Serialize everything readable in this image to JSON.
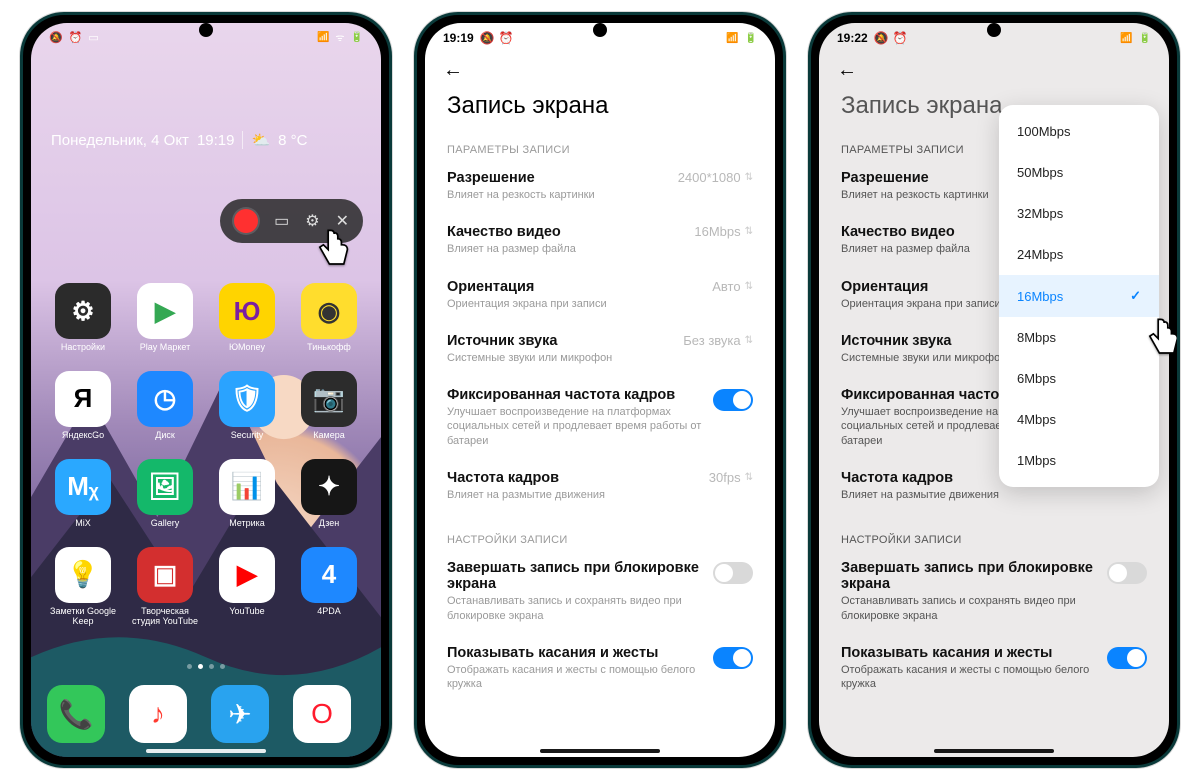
{
  "phone1": {
    "status_time_implicit": "",
    "clock_day": "Понедельник, 4 Окт",
    "clock_time": "19:19",
    "weather_temp": "8 °C",
    "apps": [
      {
        "label": "Настройки",
        "bg": "#2b2b2b",
        "glyph": "⚙"
      },
      {
        "label": "Play Маркет",
        "bg": "#ffffff",
        "glyph": "▶",
        "fg": "#34a853"
      },
      {
        "label": "ЮMoney",
        "bg": "#ffd400",
        "glyph": "Ю",
        "fg": "#7b1fa2"
      },
      {
        "label": "Тинькофф",
        "bg": "#ffdd2d",
        "glyph": "◉",
        "fg": "#333"
      },
      {
        "label": "ЯндексGo",
        "bg": "#ffffff",
        "glyph": "Я",
        "fg": "#000"
      },
      {
        "label": "Диск",
        "bg": "#1e88ff",
        "glyph": "◷"
      },
      {
        "label": "Security",
        "bg": "#2aa3ff",
        "glyph": "🛡"
      },
      {
        "label": "Камера",
        "bg": "#2c2c2c",
        "glyph": "📷"
      },
      {
        "label": "MiX",
        "bg": "#2aa8ff",
        "glyph": "Mᵪ"
      },
      {
        "label": "Gallery",
        "bg": "#14b86a",
        "glyph": "🖼"
      },
      {
        "label": "Метрика",
        "bg": "#ffffff",
        "glyph": "📊",
        "fg": "#333"
      },
      {
        "label": "Дзен",
        "bg": "#161616",
        "glyph": "✦"
      },
      {
        "label": "Заметки Google Keep",
        "bg": "#ffffff",
        "glyph": "💡",
        "fg": "#f4b400"
      },
      {
        "label": "Творческая студия YouTube",
        "bg": "#d32f2f",
        "glyph": "▣"
      },
      {
        "label": "YouTube",
        "bg": "#ffffff",
        "glyph": "▶",
        "fg": "#ff0000"
      },
      {
        "label": "4PDA",
        "bg": "#1e88ff",
        "glyph": "4"
      }
    ],
    "dock": [
      {
        "bg": "#33c75a",
        "glyph": "📞"
      },
      {
        "bg": "#ffffff",
        "glyph": "♪",
        "fg": "#ff3b30"
      },
      {
        "bg": "#29a3ef",
        "glyph": "✈"
      },
      {
        "bg": "#ffffff",
        "glyph": "O",
        "fg": "#ff1b2d"
      }
    ]
  },
  "phone2": {
    "status_time": "19:19",
    "title": "Запись экрана",
    "section_params": "ПАРАМЕТРЫ ЗАПИСИ",
    "rows": [
      {
        "name": "Разрешение",
        "sub": "Влияет на резкость картинки",
        "val": "2400*1080"
      },
      {
        "name": "Качество видео",
        "sub": "Влияет на размер файла",
        "val": "16Mbps"
      },
      {
        "name": "Ориентация",
        "sub": "Ориентация экрана при записи",
        "val": "Авто"
      },
      {
        "name": "Источник звука",
        "sub": "Системные звуки или микрофон",
        "val": "Без звука"
      }
    ],
    "fixed_fps": {
      "name": "Фиксированная частота кадров",
      "sub": "Улучшает воспроизведение на платформах социальных сетей и продлевает время работы от батареи"
    },
    "fps": {
      "name": "Частота кадров",
      "sub": "Влияет на размытие движения",
      "val": "30fps"
    },
    "section_rec": "НАСТРОЙКИ ЗАПИСИ",
    "stop_on_lock": {
      "name": "Завершать запись при блокировке экрана",
      "sub": "Останавливать запись и сохранять видео при блокировке экрана"
    },
    "show_touch": {
      "name": "Показывать касания и жесты",
      "sub": "Отображать касания и жесты с помощью белого кружка"
    }
  },
  "phone3": {
    "status_time": "19:22",
    "popup_options": [
      "100Mbps",
      "50Mbps",
      "32Mbps",
      "24Mbps",
      "16Mbps",
      "8Mbps",
      "6Mbps",
      "4Mbps",
      "1Mbps"
    ],
    "popup_selected": "16Mbps"
  }
}
